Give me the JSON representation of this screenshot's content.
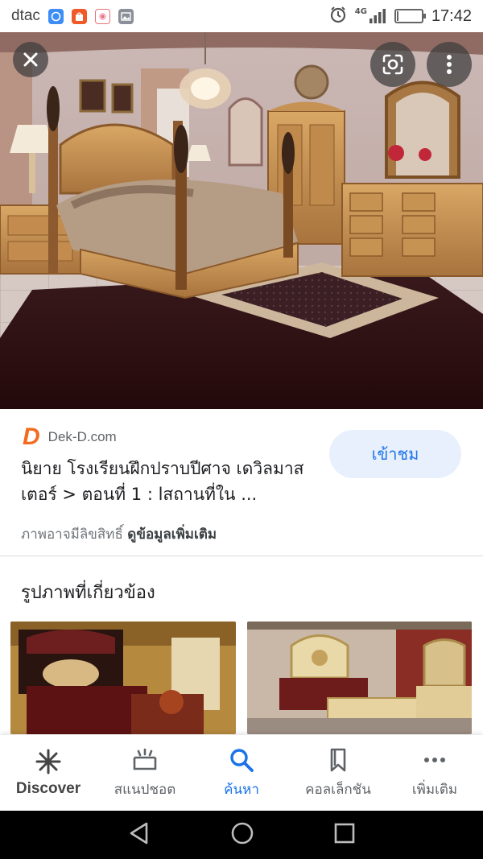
{
  "status_bar": {
    "carrier": "dtac",
    "network": "4G",
    "time": "17:42",
    "battery_level": 0.05,
    "icons": [
      "messenger-icon",
      "shopee-icon",
      "gift-icon",
      "gallery-icon",
      "alarm-icon",
      "signal-icon",
      "battery-icon"
    ]
  },
  "viewer": {
    "close_icon": "close-icon",
    "lens_icon": "google-lens-icon",
    "more_icon": "more-vert-icon"
  },
  "result": {
    "source_logo": "D",
    "source": "Dek-D.com",
    "title": "นิยาย โรงเรียนฝึกปราบปีศาจ เดวิลมาสเตอร์ > ตอนที่ 1 : lสถานที่ใน ...",
    "visit_label": "เข้าชม",
    "copyright_text": "ภาพอาจมีลิขสิทธิ์",
    "more_info_link": "ดูข้อมูลเพิ่มเติม"
  },
  "related": {
    "title": "รูปภาพที่เกี่ยวข้อง"
  },
  "bottom_nav": [
    {
      "label": "Discover",
      "icon": "asterisk-icon"
    },
    {
      "label": "สแนปชอต",
      "icon": "snapshot-icon"
    },
    {
      "label": "ค้นหา",
      "icon": "search-icon"
    },
    {
      "label": "คอลเล็กชัน",
      "icon": "bookmark-icon"
    },
    {
      "label": "เพิ่มเติม",
      "icon": "more-horiz-icon"
    }
  ],
  "colors": {
    "accent": "#1a73e8",
    "visit_button_bg": "#e8f0fe",
    "brand_orange": "#f26b1f"
  }
}
